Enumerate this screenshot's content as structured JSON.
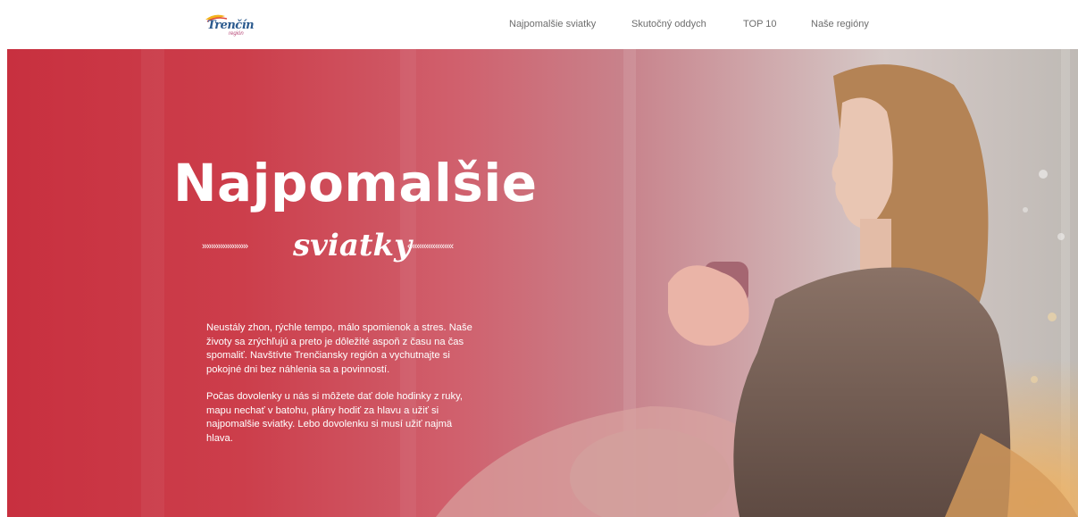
{
  "brand": {
    "logo_text": "Trenčín",
    "logo_sub": "región"
  },
  "nav": {
    "items": [
      {
        "label": "Najpomalšie sviatky"
      },
      {
        "label": "Skutočný oddych"
      },
      {
        "label": "TOP 10"
      },
      {
        "label": "Naše regióny"
      }
    ]
  },
  "hero": {
    "title": "Najpomalšie",
    "subtitle": "sviatky",
    "arrows_left": "»»»»»»»»»»",
    "arrows_right": "««««««««««",
    "paragraphs": [
      "Neustály zhon, rýchle tempo, málo spomienok a stres. Naše životy sa zrýchľujú a preto je dôležité aspoň z času na čas spomaliť. Navštívte Trenčiansky región a vychutnajte si pokojné dni bez náhlenia sa a povinností.",
      "Počas dovolenky u nás si môžete dať dole hodinky z ruky, mapu nechať v batohu, plány hodiť za hlavu a užiť si najpomalšie sviatky. Lebo dovolenku si musí užiť najmä hlava."
    ]
  },
  "colors": {
    "accent_red": "#c8303f",
    "nav_text": "#6d6d6d",
    "logo_blue": "#2b5a8e"
  }
}
